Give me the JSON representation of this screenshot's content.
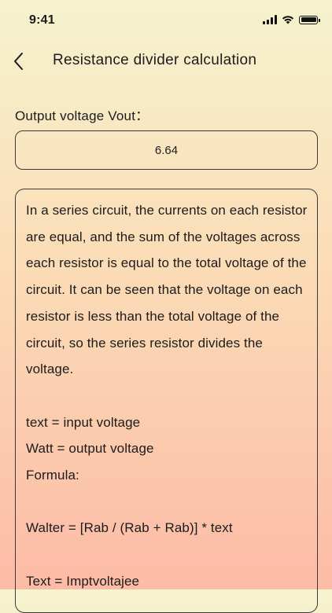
{
  "status_bar": {
    "time": "9:41",
    "signal_icon": "cellular-signal-icon",
    "wifi_icon": "wifi-icon",
    "battery_icon": "battery-icon"
  },
  "nav": {
    "back_icon": "chevron-left-icon",
    "title": "Resistance divider calculation"
  },
  "output": {
    "label": "Output voltage Vout：",
    "value": "6.64"
  },
  "info": {
    "paragraph": "In a series circuit, the currents on each resistor are equal, and the sum of the voltages across each resistor is equal to the total voltage of the circuit. It can be seen that the voltage on each resistor is less than the total voltage of the circuit, so the series resistor divides the voltage.",
    "def_text": "text = input voltage",
    "def_watt": "Watt = output voltage",
    "formula_label": "Formula:",
    "formula": "Walter = [Rab / (Rab + Rab)] * text",
    "text_def": "Text = Imptvoltajee"
  },
  "colors": {
    "background_top": "#f6f3cf",
    "background_bottom": "#fcbba6",
    "border": "#3a3a3a",
    "text": "#1c1c1c"
  }
}
